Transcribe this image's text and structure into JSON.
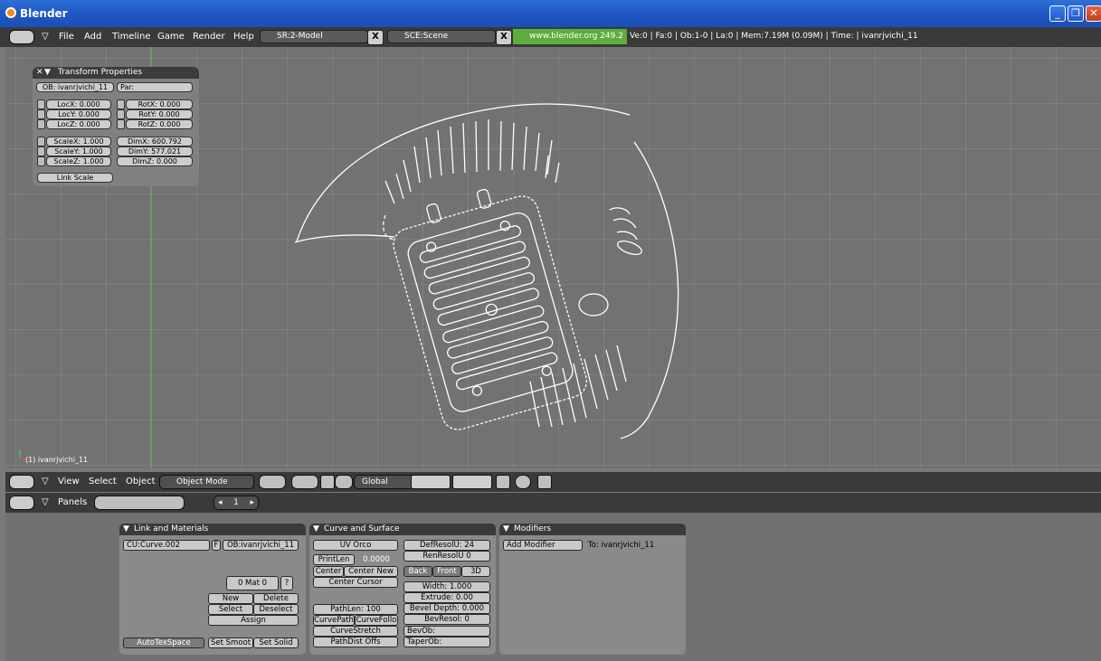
{
  "window": {
    "title": "Blender"
  },
  "infobar": {
    "menus": [
      "File",
      "Add",
      "Timeline",
      "Game",
      "Render",
      "Help"
    ],
    "screen": "SR:2-Model",
    "scene": "SCE:Scene",
    "website": "www.blender.org 249.2",
    "stats": "Ve:0 | Fa:0 | Ob:1-0 | La:0 | Mem:7.19M (0.09M) | Time: | ivanrjvichi_11"
  },
  "transform": {
    "title": "Transform Properties",
    "ob": "OB: ivanrjvichi_11",
    "par": "Par:",
    "locx": "LocX: 0.000",
    "locy": "LocY: 0.000",
    "locz": "LocZ: 0.000",
    "rotx": "RotX: 0.000",
    "roty": "RotY: 0.000",
    "rotz": "RotZ: 0.000",
    "scalex": "ScaleX: 1.000",
    "scaley": "ScaleY: 1.000",
    "scalez": "ScaleZ: 1.000",
    "dimx": "DimX: 600.792",
    "dimy": "DimY: 577.021",
    "dimz": "DimZ: 0.000",
    "link_scale": "Link Scale"
  },
  "viewport": {
    "object_label": "(1) ivanrjvichi_11"
  },
  "view_header": {
    "menus": [
      "View",
      "Select",
      "Object"
    ],
    "mode": "Object Mode",
    "orientation": "Global"
  },
  "panels_header": {
    "label": "Panels",
    "frame": "1"
  },
  "link_materials": {
    "title": "Link and Materials",
    "curve": "CU:Curve.002",
    "f": "F",
    "ob": "OB:ivanrjvichi_11",
    "mat": "0 Mat 0",
    "q": "?",
    "new": "New",
    "delete": "Delete",
    "select": "Select",
    "deselect": "Deselect",
    "assign": "Assign",
    "autotex": "AutoTexSpace",
    "set_smooth": "Set Smoot",
    "set_solid": "Set Solid"
  },
  "curve_surface": {
    "title": "Curve and Surface",
    "uv_orco": "UV Orco",
    "printlen": "PrintLen",
    "printlen_val": "0.0000",
    "center": "Center",
    "center_new": "Center New",
    "center_cursor": "Center Cursor",
    "pathlen": "PathLen: 100",
    "curvepath": "CurvePath",
    "curvefollow": "CurveFollo",
    "curvestretch": "CurveStretch",
    "pathdist": "PathDist Offs",
    "defresolu": "DefResolU: 24",
    "renresolu": "RenResolU 0",
    "back": "Back",
    "front": "Front",
    "three_d": "3D",
    "width": "Width: 1.000",
    "extrude": "Extrude: 0.00",
    "bevel_depth": "Bevel Depth: 0.000",
    "bevresol": "BevResol: 0",
    "bevob": "BevOb:",
    "taperob": "TaperOb:"
  },
  "modifiers": {
    "title": "Modifiers",
    "add": "Add Modifier",
    "to": "To: ivanrjvichi_11"
  }
}
